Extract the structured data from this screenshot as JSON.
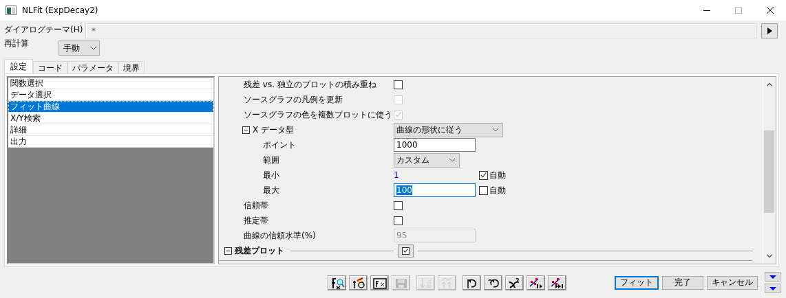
{
  "window": {
    "title": "NLFit (ExpDecay2)"
  },
  "theme": {
    "label": "ダイアログテーマ(H)",
    "value": "*"
  },
  "recalc": {
    "label": "再計算",
    "value": "手動"
  },
  "tabs": [
    {
      "label": "設定",
      "selected": true
    },
    {
      "label": "コード",
      "selected": false
    },
    {
      "label": "パラメータ",
      "selected": false
    },
    {
      "label": "境界",
      "selected": false
    }
  ],
  "nav_items": [
    {
      "label": "関数選択",
      "selected": false
    },
    {
      "label": "データ選択",
      "selected": false
    },
    {
      "label": "フィット曲線",
      "selected": true
    },
    {
      "label": "X/Y検索",
      "selected": false
    },
    {
      "label": "詳細",
      "selected": false
    },
    {
      "label": "出力",
      "selected": false
    }
  ],
  "properties": [
    {
      "kind": "checkbox",
      "label": "残差 vs. 独立のプロットの積み重ね",
      "checked": false,
      "disabled": false
    },
    {
      "kind": "checkbox",
      "label": "ソースグラフの凡例を更新",
      "checked": false,
      "disabled": true
    },
    {
      "kind": "checkbox",
      "label": "ソースグラフの色を複数プロットに使う",
      "checked": true,
      "disabled": true
    },
    {
      "kind": "combo",
      "label": "X データ型",
      "value": "曲線の形状に従う",
      "expanded": true,
      "children": [
        {
          "kind": "input",
          "label": "ポイント",
          "value": "1000",
          "disabled": false,
          "text_selected": false
        },
        {
          "kind": "combo",
          "label": "範囲",
          "value": "カスタム"
        },
        {
          "kind": "value",
          "label": "最小",
          "value": "1",
          "auto_label": "自動",
          "auto": true
        },
        {
          "kind": "input",
          "label": "最大",
          "value": "100",
          "disabled": false,
          "text_selected": true,
          "auto_label": "自動",
          "auto": false
        }
      ]
    },
    {
      "kind": "checkbox",
      "label": "信頼帯",
      "checked": false,
      "disabled": false
    },
    {
      "kind": "checkbox",
      "label": "推定帯",
      "checked": false,
      "disabled": false
    },
    {
      "kind": "input",
      "label": "曲線の信頼水準(%)",
      "value": "95",
      "disabled": true,
      "text_selected": false
    },
    {
      "kind": "section",
      "label": "残差プロット",
      "expanded": true,
      "checked": true
    }
  ],
  "toolbar_groups": [
    [
      {
        "disabled": false
      },
      {
        "disabled": false
      },
      {
        "disabled": false
      },
      {
        "disabled": true
      }
    ],
    [
      {
        "disabled": true
      },
      {
        "disabled": true
      }
    ],
    [
      {
        "disabled": false
      },
      {
        "disabled": false
      },
      {
        "disabled": false
      },
      {
        "disabled": false
      },
      {
        "disabled": false
      }
    ]
  ],
  "buttons": [
    {
      "label": "フィット",
      "focused": true
    },
    {
      "label": "完了",
      "focused": false
    },
    {
      "label": "キャンセル",
      "focused": false
    }
  ]
}
